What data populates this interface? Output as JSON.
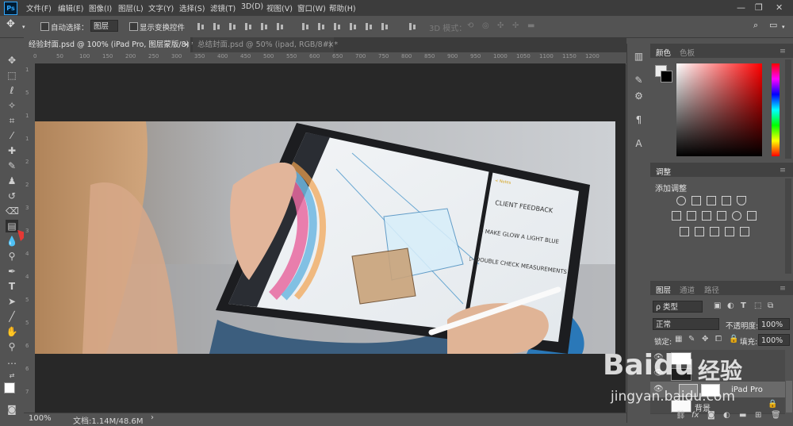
{
  "app": {
    "logo": "Ps"
  },
  "menu": [
    "文件(F)",
    "编辑(E)",
    "图像(I)",
    "图层(L)",
    "文字(Y)",
    "选择(S)",
    "滤镜(T)",
    "3D(D)",
    "视图(V)",
    "窗口(W)",
    "帮助(H)"
  ],
  "window_controls": {
    "minimize": "—",
    "restore": "❐",
    "close": "✕"
  },
  "options": {
    "auto_select_label": "自动选择：",
    "auto_select_value": "图层",
    "show_transform_label": "显示变换控件",
    "mode_3d_label": "3D 模式："
  },
  "tabs": [
    {
      "title": "经验封面.psd @ 100% (iPad Pro, 图层蒙版/8) *",
      "close": "×"
    },
    {
      "title": "总结封面.psd @ 50% (ipad, RGB/8#) *",
      "close": "×"
    }
  ],
  "ruler": {
    "top": [
      "0",
      "50",
      "100",
      "150",
      "200",
      "250",
      "300",
      "350",
      "400",
      "450",
      "500",
      "550",
      "600",
      "650",
      "700",
      "750",
      "800",
      "850",
      "900",
      "950",
      "1000",
      "1050",
      "1100",
      "1150",
      "1200"
    ],
    "left": [
      "1",
      "5",
      "1",
      "1",
      "2",
      "2",
      "3",
      "3",
      "4",
      "4",
      "5",
      "5",
      "6",
      "6",
      "7"
    ]
  },
  "status": {
    "zoom": "100%",
    "doc": "文档:1.14M/48.6M",
    "arrow": "›"
  },
  "panels": {
    "color_tab": "颜色",
    "swatches_tab": "色板",
    "adjustments_tab": "调整",
    "add_adjustment": "添加调整",
    "layers_tab": "图层",
    "channels_tab": "通道",
    "paths_tab": "路径",
    "layer_filter": "ρ 类型",
    "blend_mode": "正常",
    "opacity_label": "不透明度:",
    "opacity_value": "100%",
    "lock_label": "锁定:",
    "fill_label": "填充:",
    "fill_value": "100%",
    "layers": [
      {
        "name": "iPad Pro"
      },
      {
        "name": "背景"
      }
    ],
    "bottom_fx": "fx"
  },
  "canvas_sketch": {
    "note1": "CLIENT FEEDBACK",
    "note2": "▷ MAKE GLOW A LIGHT BLUE",
    "note3": "▷ DOUBLE CHECK MEASUREMENTS",
    "back_label": "< Notes"
  },
  "watermark": {
    "brand": "Baidu",
    "cn": "经验",
    "url": "jingyan.baidu.com"
  },
  "colors": {
    "foreground": "#ffffff",
    "background": "#000000",
    "accent_red": "#e53935"
  }
}
